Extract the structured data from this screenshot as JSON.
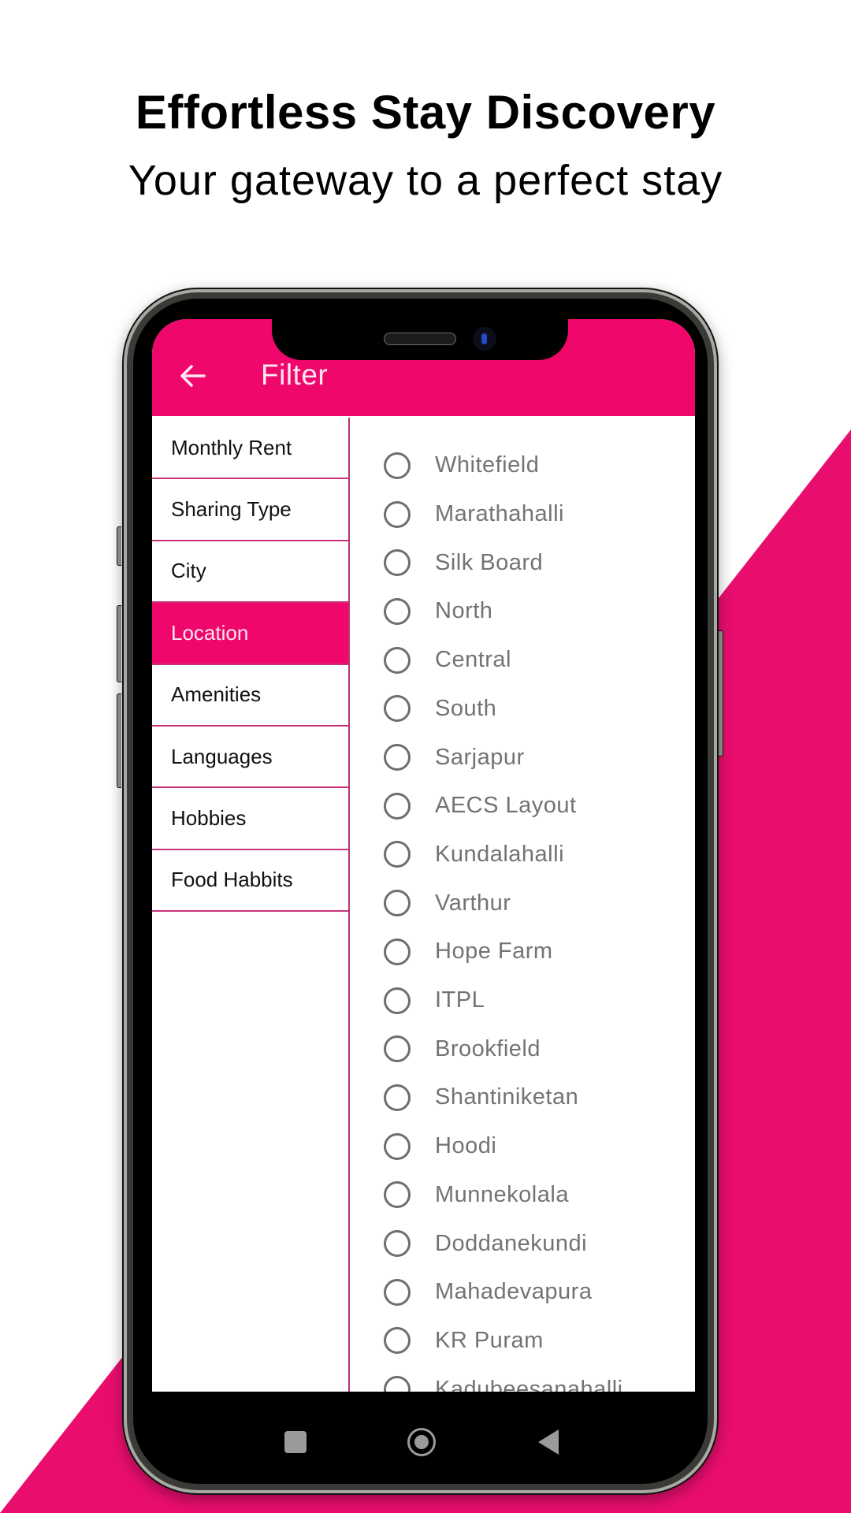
{
  "hero": {
    "title": "Effortless Stay Discovery",
    "subtitle": "Your gateway to a perfect stay"
  },
  "colors": {
    "brand_pink": "#ef076c",
    "background_pink": "#e90e6e",
    "option_text": "#737373"
  },
  "appbar": {
    "back_icon": "arrow-left-icon",
    "title": "Filter"
  },
  "side_menu": {
    "selected": "Location",
    "items": [
      {
        "label": "Monthly Rent"
      },
      {
        "label": "Sharing Type"
      },
      {
        "label": "City"
      },
      {
        "label": "Location"
      },
      {
        "label": "Amenities"
      },
      {
        "label": "Languages"
      },
      {
        "label": "Hobbies"
      },
      {
        "label": "Food Habbits"
      }
    ]
  },
  "locations": [
    {
      "label": "Whitefield",
      "selected": false
    },
    {
      "label": "Marathahalli",
      "selected": false
    },
    {
      "label": "Silk Board",
      "selected": false
    },
    {
      "label": "North",
      "selected": false
    },
    {
      "label": "Central",
      "selected": false
    },
    {
      "label": "South",
      "selected": false
    },
    {
      "label": "Sarjapur",
      "selected": false
    },
    {
      "label": "AECS Layout",
      "selected": false
    },
    {
      "label": "Kundalahalli",
      "selected": false
    },
    {
      "label": "Varthur",
      "selected": false
    },
    {
      "label": "Hope Farm",
      "selected": false
    },
    {
      "label": "ITPL",
      "selected": false
    },
    {
      "label": "Brookfield",
      "selected": false
    },
    {
      "label": "Shantiniketan",
      "selected": false
    },
    {
      "label": "Hoodi",
      "selected": false
    },
    {
      "label": "Munnekolala",
      "selected": false
    },
    {
      "label": "Doddanekundi",
      "selected": false
    },
    {
      "label": "Mahadevapura",
      "selected": false
    },
    {
      "label": "KR Puram",
      "selected": false
    },
    {
      "label": "Kadubeesanahalli",
      "selected": false
    }
  ],
  "system_nav": {
    "recents_icon": "square-recents-icon",
    "home_icon": "circle-home-icon",
    "back_icon": "triangle-back-icon"
  }
}
